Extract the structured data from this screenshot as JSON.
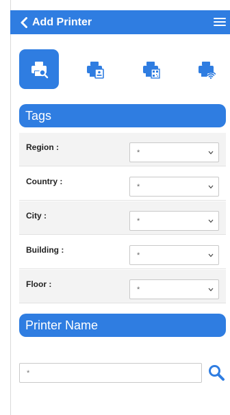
{
  "header": {
    "title": "Add Printer",
    "back_icon": "chevron-left-icon",
    "menu_icon": "hamburger-menu-icon"
  },
  "modes": [
    {
      "name": "printer-search-icon",
      "active": true
    },
    {
      "name": "printer-id-card-icon",
      "active": false
    },
    {
      "name": "printer-qr-code-icon",
      "active": false
    },
    {
      "name": "printer-wifi-icon",
      "active": false
    }
  ],
  "tags": {
    "title": "Tags",
    "rows": [
      {
        "label": "Region :",
        "value": "*"
      },
      {
        "label": "Country :",
        "value": "*"
      },
      {
        "label": "City :",
        "value": "*"
      },
      {
        "label": "Building :",
        "value": "*"
      },
      {
        "label": "Floor :",
        "value": "*"
      }
    ]
  },
  "printer_name": {
    "title": "Printer Name",
    "placeholder": "*",
    "search_icon": "magnifier-search-icon"
  },
  "colors": {
    "accent": "#2f7de1",
    "row_shade": "#f3f3f3"
  }
}
